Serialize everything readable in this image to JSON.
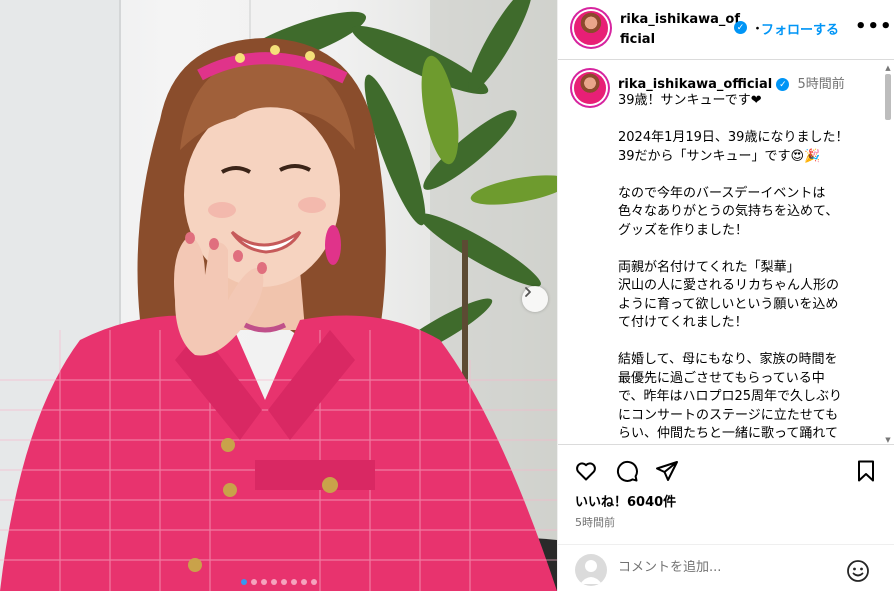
{
  "post": {
    "username": "rika_ishikawa_official",
    "follow_label": "フォローする",
    "separator": "・",
    "more_label": "•••",
    "caption": {
      "username": "rika_ishikawa_official",
      "time": "5時間前",
      "text": "39歳！サンキューです❤\n\n2024年1月19日、39歳になりました！\n39だから「サンキュー」です😍🎉\n\nなので今年のバースデーイベントは\n色々なありがとうの気持ちを込めて、\nグッズを作りました！\n\n両親が名付けてくれた「梨華」\n沢山の人に愛されるリカちゃん人形の\nように育って欲しいという願いを込め\nて付けてくれました！\n\n結婚して、母にもなり、家族の時間を\n最優先に過ごさせてもらっている中\nで、昨年はハロプロ25周年で久しぶり\nにコンサートのステージに立たせても\nらい、仲間たちと一緒に歌って踊れて\n嬉しくて、ファンの皆さんの声援に感"
    },
    "likes": "いいね！6040件",
    "posted_time": "5時間前",
    "comment_placeholder": "コメントを追加...",
    "carousel": {
      "total": 8,
      "active": 1
    },
    "colors": {
      "accent": "#0095f6",
      "jacket": "#e8336e",
      "story_ring": "#d6249f"
    },
    "icons": [
      "heart-icon",
      "comment-icon",
      "share-icon",
      "bookmark-icon",
      "emoji-icon",
      "chevron-right-icon",
      "verified-badge-icon"
    ]
  }
}
